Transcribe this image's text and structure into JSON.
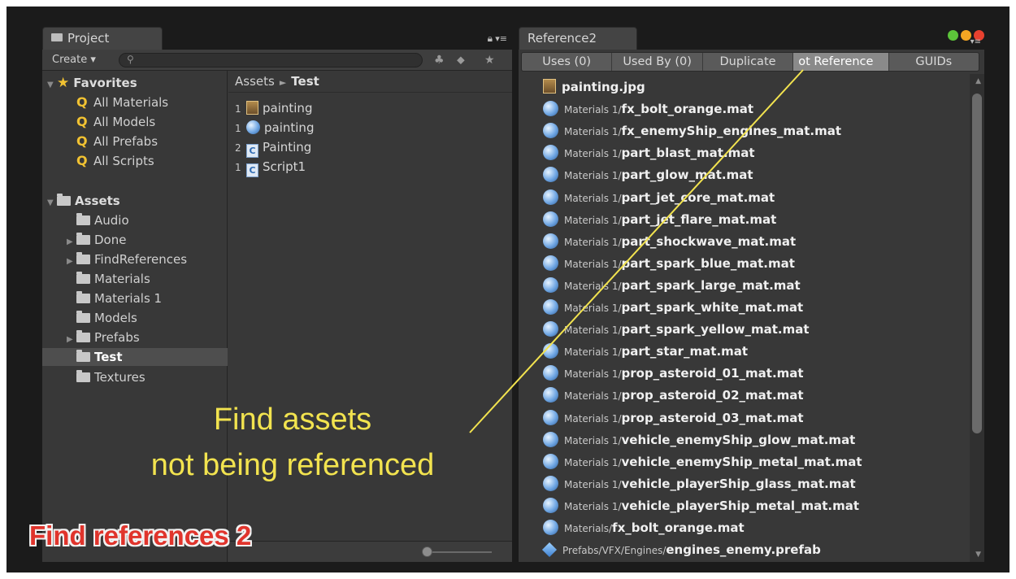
{
  "project": {
    "tab_label": "Project",
    "create_label": "Create ▾",
    "search_placeholder": "",
    "tree": {
      "favorites_label": "Favorites",
      "favorites": [
        "All Materials",
        "All Models",
        "All Prefabs",
        "All Scripts"
      ],
      "assets_label": "Assets",
      "folders": [
        {
          "label": "Audio",
          "expandable": false
        },
        {
          "label": "Done",
          "expandable": true
        },
        {
          "label": "FindReferences",
          "expandable": true
        },
        {
          "label": "Materials",
          "expandable": false
        },
        {
          "label": "Materials 1",
          "expandable": false
        },
        {
          "label": "Models",
          "expandable": false
        },
        {
          "label": "Prefabs",
          "expandable": true
        },
        {
          "label": "Test",
          "expandable": false,
          "selected": true
        },
        {
          "label": "Textures",
          "expandable": false
        }
      ]
    },
    "breadcrumb": {
      "root": "Assets",
      "separator": "►",
      "current": "Test"
    },
    "items": [
      {
        "count": "1",
        "icon": "texture-icon",
        "label": "painting"
      },
      {
        "count": "1",
        "icon": "material-icon",
        "label": "painting"
      },
      {
        "count": "2",
        "icon": "script-icon",
        "label": "Painting"
      },
      {
        "count": "1",
        "icon": "script-icon",
        "label": "Script1"
      }
    ]
  },
  "reference": {
    "tab_label": "Reference2",
    "tabs": [
      "Uses (0)",
      "Used By (0)",
      "Duplicate",
      "ot Referencе",
      "GUIDs"
    ],
    "active_tab": 3,
    "rows": [
      {
        "icon": "texture-icon",
        "path": "",
        "name": "painting.jpg"
      },
      {
        "icon": "material-icon",
        "path": "Materials 1/",
        "name": "fx_bolt_orange.mat"
      },
      {
        "icon": "material-icon",
        "path": "Materials 1/",
        "name": "fx_enemyShip_engines_mat.mat"
      },
      {
        "icon": "material-icon",
        "path": "Materials 1/",
        "name": "part_blast_mat.mat"
      },
      {
        "icon": "material-icon",
        "path": "Materials 1/",
        "name": "part_glow_mat.mat"
      },
      {
        "icon": "material-icon",
        "path": "Materials 1/",
        "name": "part_jet_core_mat.mat"
      },
      {
        "icon": "material-icon",
        "path": "Materials 1/",
        "name": "part_jet_flare_mat.mat"
      },
      {
        "icon": "material-icon",
        "path": "Materials 1/",
        "name": "part_shockwave_mat.mat"
      },
      {
        "icon": "material-icon",
        "path": "Materials 1/",
        "name": "part_spark_blue_mat.mat"
      },
      {
        "icon": "material-icon",
        "path": "Materials 1/",
        "name": "part_spark_large_mat.mat"
      },
      {
        "icon": "material-icon",
        "path": "Materials 1/",
        "name": "part_spark_white_mat.mat"
      },
      {
        "icon": "material-icon",
        "path": "Materials 1/",
        "name": "part_spark_yellow_mat.mat"
      },
      {
        "icon": "material-icon",
        "path": "Materials 1/",
        "name": "part_star_mat.mat"
      },
      {
        "icon": "material-icon",
        "path": "Materials 1/",
        "name": "prop_asteroid_01_mat.mat"
      },
      {
        "icon": "material-icon",
        "path": "Materials 1/",
        "name": "prop_asteroid_02_mat.mat"
      },
      {
        "icon": "material-icon",
        "path": "Materials 1/",
        "name": "prop_asteroid_03_mat.mat"
      },
      {
        "icon": "material-icon",
        "path": "Materials 1/",
        "name": "vehicle_enemyShip_glow_mat.mat"
      },
      {
        "icon": "material-icon",
        "path": "Materials 1/",
        "name": "vehicle_enemyShip_metal_mat.mat"
      },
      {
        "icon": "material-icon",
        "path": "Materials 1/",
        "name": "vehicle_playerShip_glass_mat.mat"
      },
      {
        "icon": "material-icon",
        "path": "Materials 1/",
        "name": "vehicle_playerShip_metal_mat.mat"
      },
      {
        "icon": "material-icon",
        "path": "Materials/",
        "name": "fx_bolt_orange.mat"
      },
      {
        "icon": "prefab-icon",
        "path": "Prefabs/VFX/Engines/",
        "name": "engines_enemy.prefab"
      }
    ]
  },
  "annotation": {
    "caption_line1": "Find assets",
    "caption_line2": "not being referenced",
    "brand": "Find references 2",
    "caption_color": "#f2e34f",
    "brand_color": "#e0342c"
  },
  "colors": {
    "window_buttons": [
      "#5cc43a",
      "#f5a623",
      "#e8412f"
    ]
  }
}
